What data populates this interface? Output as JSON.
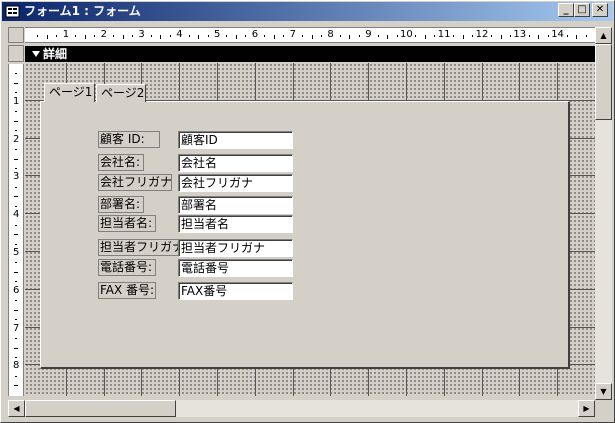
{
  "window": {
    "title": "フォーム1 : フォーム",
    "icon": "form-icon",
    "buttons": {
      "minimize": "_",
      "maximize": "□",
      "close": "✕"
    }
  },
  "section": {
    "label": "詳細",
    "icon": "arrow-down-icon"
  },
  "ruler": {
    "horizontal": [
      "1",
      "2",
      "3",
      "4",
      "5",
      "6",
      "7",
      "8",
      "9",
      "10",
      "11",
      "12",
      "13",
      "14"
    ],
    "vertical": [
      "1",
      "2",
      "3",
      "4",
      "5",
      "6",
      "7",
      "8"
    ]
  },
  "tabs": [
    {
      "label": "ページ1",
      "selected": true
    },
    {
      "label": "ページ2",
      "selected": false
    }
  ],
  "fields": [
    {
      "label": "顧客 ID:",
      "value": "顧客ID"
    },
    {
      "label": "会社名:",
      "value": "会社名"
    },
    {
      "label": "会社フリガナ:",
      "value": "会社フリガナ"
    },
    {
      "label": "部署名:",
      "value": "部署名"
    },
    {
      "label": "担当者名:",
      "value": "担当者名"
    },
    {
      "label": "担当者フリガナ:",
      "value": "担当者フリガナ"
    },
    {
      "label": "電話番号:",
      "value": "電話番号"
    },
    {
      "label": "FAX 番号:",
      "value": "FAX番号"
    }
  ],
  "colors": {
    "titlebar_start": "#0a246a",
    "titlebar_end": "#a6caf0",
    "face": "#d4d0c8"
  }
}
